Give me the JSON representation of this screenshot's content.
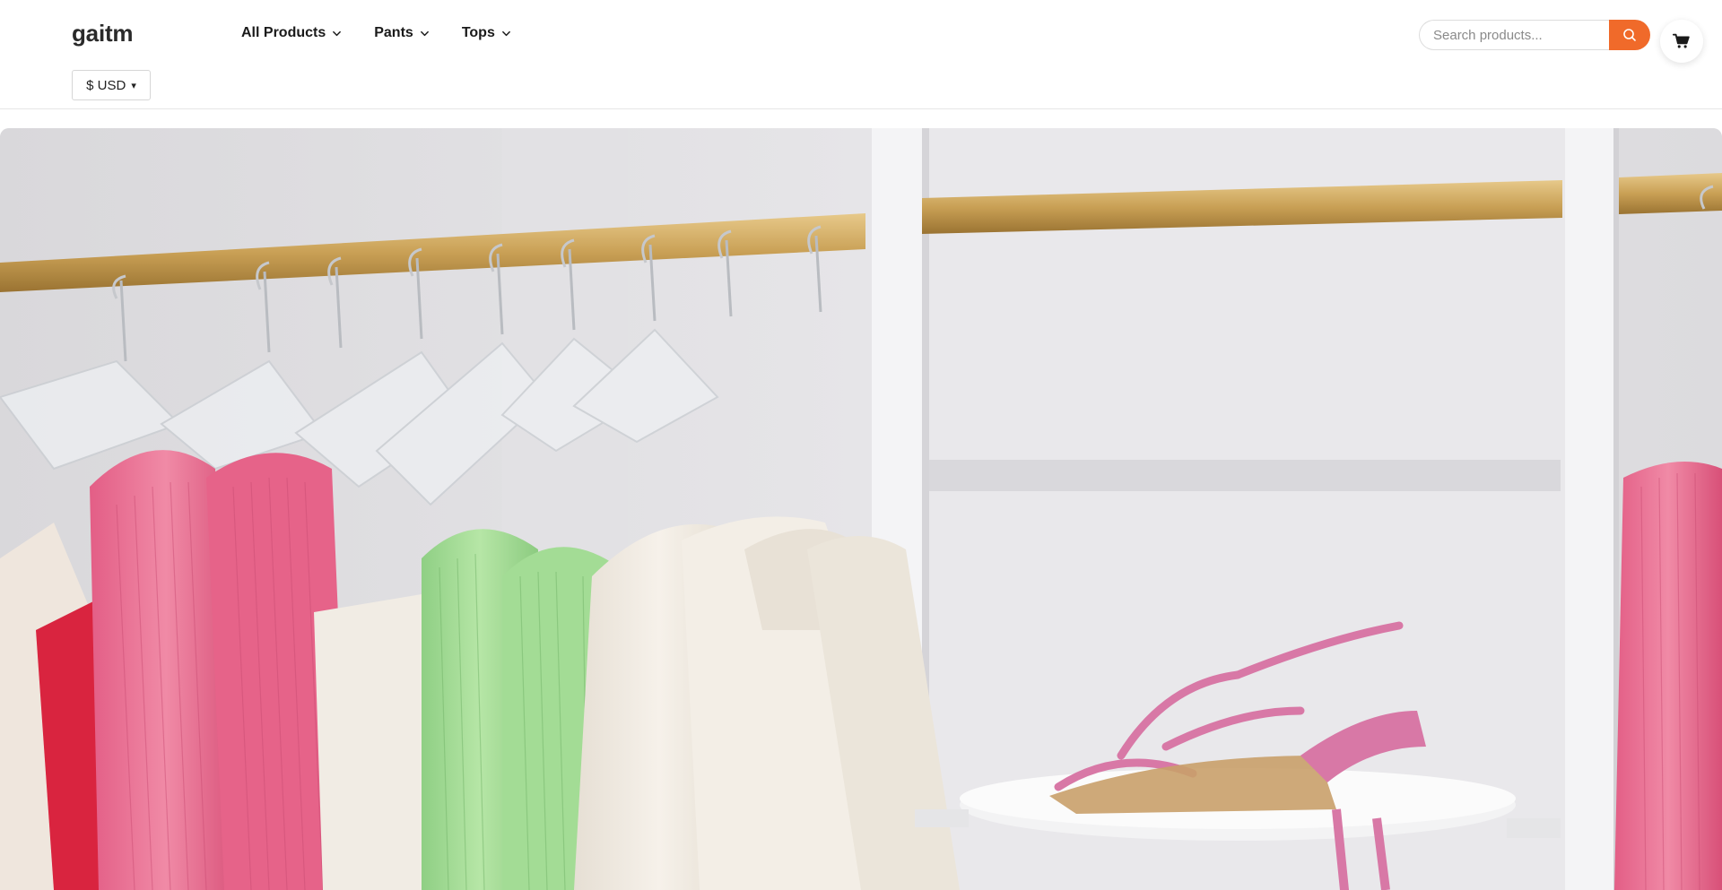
{
  "brand": {
    "name": "gaitm"
  },
  "nav": {
    "items": [
      {
        "label": "All Products",
        "icon": "chevron-down-icon"
      },
      {
        "label": "Pants",
        "icon": "chevron-down-icon"
      },
      {
        "label": "Tops",
        "icon": "chevron-down-icon"
      }
    ]
  },
  "currency": {
    "selected": "$ USD",
    "caret": "▾"
  },
  "search": {
    "placeholder": "Search products...",
    "value": "",
    "button_icon": "search-icon"
  },
  "cart": {
    "icon": "cart-icon"
  },
  "hero": {
    "image": "clothing-rack-photo"
  },
  "colors": {
    "accent": "#f06a2a",
    "border": "#dcdcdc",
    "text": "#1a1a1a"
  }
}
